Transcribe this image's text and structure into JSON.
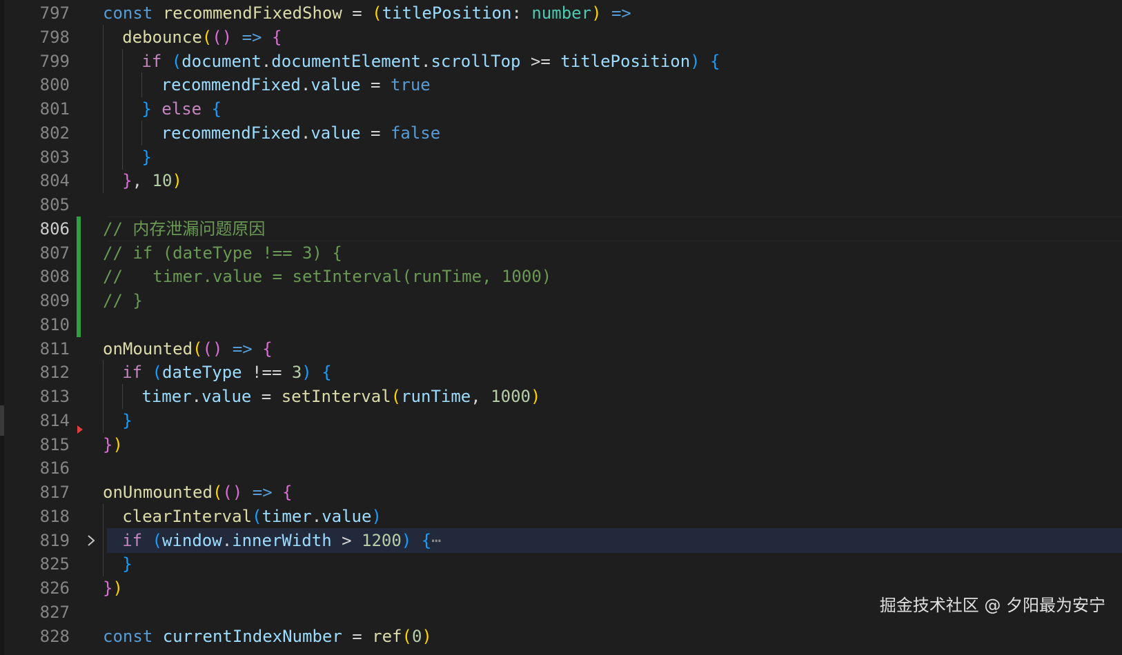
{
  "editor": {
    "current_line": 806,
    "lines": [
      {
        "n": "797",
        "indent": 0,
        "tokens": [
          [
            "const ",
            "kw"
          ],
          [
            "recommendFixedShow",
            "fn"
          ],
          [
            " = ",
            "op"
          ],
          [
            "(",
            "b1"
          ],
          [
            "titlePosition",
            "var"
          ],
          [
            ": ",
            "op"
          ],
          [
            "number",
            "type"
          ],
          [
            ")",
            "b1"
          ],
          [
            " =>",
            "kw"
          ]
        ]
      },
      {
        "n": "798",
        "indent": 1,
        "tokens": [
          [
            "debounce",
            "fn"
          ],
          [
            "(",
            "b1"
          ],
          [
            "()",
            "b2"
          ],
          [
            " => ",
            "kw"
          ],
          [
            "{",
            "b2"
          ]
        ]
      },
      {
        "n": "799",
        "indent": 2,
        "tokens": [
          [
            "if",
            "ctl"
          ],
          [
            " ",
            "op"
          ],
          [
            "(",
            "b3"
          ],
          [
            "document",
            "var"
          ],
          [
            ".",
            "op"
          ],
          [
            "documentElement",
            "var"
          ],
          [
            ".",
            "op"
          ],
          [
            "scrollTop",
            "var"
          ],
          [
            " >= ",
            "op"
          ],
          [
            "titlePosition",
            "var"
          ],
          [
            ")",
            "b3"
          ],
          [
            " ",
            "op"
          ],
          [
            "{",
            "b3"
          ]
        ]
      },
      {
        "n": "800",
        "indent": 3,
        "tokens": [
          [
            "recommendFixed",
            "var"
          ],
          [
            ".",
            "op"
          ],
          [
            "value",
            "var"
          ],
          [
            " = ",
            "op"
          ],
          [
            "true",
            "kw"
          ]
        ]
      },
      {
        "n": "801",
        "indent": 2,
        "tokens": [
          [
            "}",
            "b3"
          ],
          [
            " ",
            "op"
          ],
          [
            "else",
            "ctl"
          ],
          [
            " ",
            "op"
          ],
          [
            "{",
            "b3"
          ]
        ]
      },
      {
        "n": "802",
        "indent": 3,
        "tokens": [
          [
            "recommendFixed",
            "var"
          ],
          [
            ".",
            "op"
          ],
          [
            "value",
            "var"
          ],
          [
            " = ",
            "op"
          ],
          [
            "false",
            "kw"
          ]
        ]
      },
      {
        "n": "803",
        "indent": 2,
        "tokens": [
          [
            "}",
            "b3"
          ]
        ]
      },
      {
        "n": "804",
        "indent": 1,
        "tokens": [
          [
            "}",
            "b2"
          ],
          [
            ", ",
            "op"
          ],
          [
            "10",
            "num"
          ],
          [
            ")",
            "b1"
          ]
        ]
      },
      {
        "n": "805",
        "indent": 0,
        "tokens": []
      },
      {
        "n": "806",
        "indent": 0,
        "tokens": [
          [
            "// 内存泄漏问题原因",
            "cm"
          ]
        ]
      },
      {
        "n": "807",
        "indent": 0,
        "tokens": [
          [
            "// if (dateType !== 3) {",
            "cm"
          ]
        ]
      },
      {
        "n": "808",
        "indent": 0,
        "tokens": [
          [
            "//   timer.value = setInterval(runTime, 1000)",
            "cm"
          ]
        ]
      },
      {
        "n": "809",
        "indent": 0,
        "tokens": [
          [
            "// }",
            "cm"
          ]
        ]
      },
      {
        "n": "810",
        "indent": 0,
        "tokens": []
      },
      {
        "n": "811",
        "indent": 0,
        "tokens": [
          [
            "onMounted",
            "fn"
          ],
          [
            "(",
            "b1"
          ],
          [
            "()",
            "b2"
          ],
          [
            " => ",
            "kw"
          ],
          [
            "{",
            "b2"
          ]
        ]
      },
      {
        "n": "812",
        "indent": 1,
        "tokens": [
          [
            "if",
            "ctl"
          ],
          [
            " ",
            "op"
          ],
          [
            "(",
            "b3"
          ],
          [
            "dateType",
            "var"
          ],
          [
            " !== ",
            "op"
          ],
          [
            "3",
            "num"
          ],
          [
            ")",
            "b3"
          ],
          [
            " ",
            "op"
          ],
          [
            "{",
            "b3"
          ]
        ]
      },
      {
        "n": "813",
        "indent": 2,
        "tokens": [
          [
            "timer",
            "var"
          ],
          [
            ".",
            "op"
          ],
          [
            "value",
            "var"
          ],
          [
            " = ",
            "op"
          ],
          [
            "setInterval",
            "fn"
          ],
          [
            "(",
            "b1"
          ],
          [
            "runTime",
            "var"
          ],
          [
            ", ",
            "op"
          ],
          [
            "1000",
            "num"
          ],
          [
            ")",
            "b1"
          ]
        ]
      },
      {
        "n": "814",
        "indent": 1,
        "tokens": [
          [
            "}",
            "b3"
          ]
        ]
      },
      {
        "n": "815",
        "indent": 0,
        "tokens": [
          [
            "}",
            "b2"
          ],
          [
            ")",
            "b1"
          ]
        ]
      },
      {
        "n": "816",
        "indent": 0,
        "tokens": []
      },
      {
        "n": "817",
        "indent": 0,
        "tokens": [
          [
            "onUnmounted",
            "fn"
          ],
          [
            "(",
            "b1"
          ],
          [
            "()",
            "b2"
          ],
          [
            " => ",
            "kw"
          ],
          [
            "{",
            "b2"
          ]
        ]
      },
      {
        "n": "818",
        "indent": 1,
        "tokens": [
          [
            "clearInterval",
            "fn"
          ],
          [
            "(",
            "b3"
          ],
          [
            "timer",
            "var"
          ],
          [
            ".",
            "op"
          ],
          [
            "value",
            "var"
          ],
          [
            ")",
            "b3"
          ]
        ]
      },
      {
        "n": "819",
        "indent": 1,
        "tokens": [
          [
            "if",
            "ctl"
          ],
          [
            " ",
            "op"
          ],
          [
            "(",
            "b3"
          ],
          [
            "window",
            "var"
          ],
          [
            ".",
            "op"
          ],
          [
            "innerWidth",
            "var"
          ],
          [
            " > ",
            "op"
          ],
          [
            "1200",
            "num"
          ],
          [
            ")",
            "b3"
          ],
          [
            " ",
            "op"
          ],
          [
            "{",
            "b3"
          ],
          [
            "⋯",
            "ell"
          ]
        ]
      },
      {
        "n": "825",
        "indent": 1,
        "tokens": [
          [
            "}",
            "b3"
          ]
        ]
      },
      {
        "n": "826",
        "indent": 0,
        "tokens": [
          [
            "}",
            "b2"
          ],
          [
            ")",
            "b1"
          ]
        ]
      },
      {
        "n": "827",
        "indent": 0,
        "tokens": []
      },
      {
        "n": "828",
        "indent": 0,
        "tokens": [
          [
            "const ",
            "kw"
          ],
          [
            "currentIndexNumber",
            "var"
          ],
          [
            " = ",
            "op"
          ],
          [
            "ref",
            "fn"
          ],
          [
            "(",
            "b1"
          ],
          [
            "0",
            "num"
          ],
          [
            ")",
            "b1"
          ]
        ]
      }
    ],
    "diff_added_lines": [
      "806",
      "807",
      "808",
      "809",
      "810"
    ],
    "deleted_marker_line": "815",
    "folded_line": "819",
    "fold_icon": "chevron-right-icon"
  },
  "watermark": {
    "text": "掘金技术社区 @ 夕阳最为安宁"
  },
  "colors": {
    "background": "#1e1e1e",
    "line_number": "#858585",
    "line_number_active": "#cccccc",
    "diff_added": "#2ea043",
    "diff_deleted": "#e03e3e",
    "keyword": "#569cd6",
    "control": "#c586c0",
    "function": "#dcdcaa",
    "variable": "#9cdcfe",
    "type": "#4ec9b0",
    "number": "#b5cea8",
    "comment": "#6a9955",
    "bracket_1": "#ffd700",
    "bracket_2": "#da70d6",
    "bracket_3": "#179fff"
  }
}
